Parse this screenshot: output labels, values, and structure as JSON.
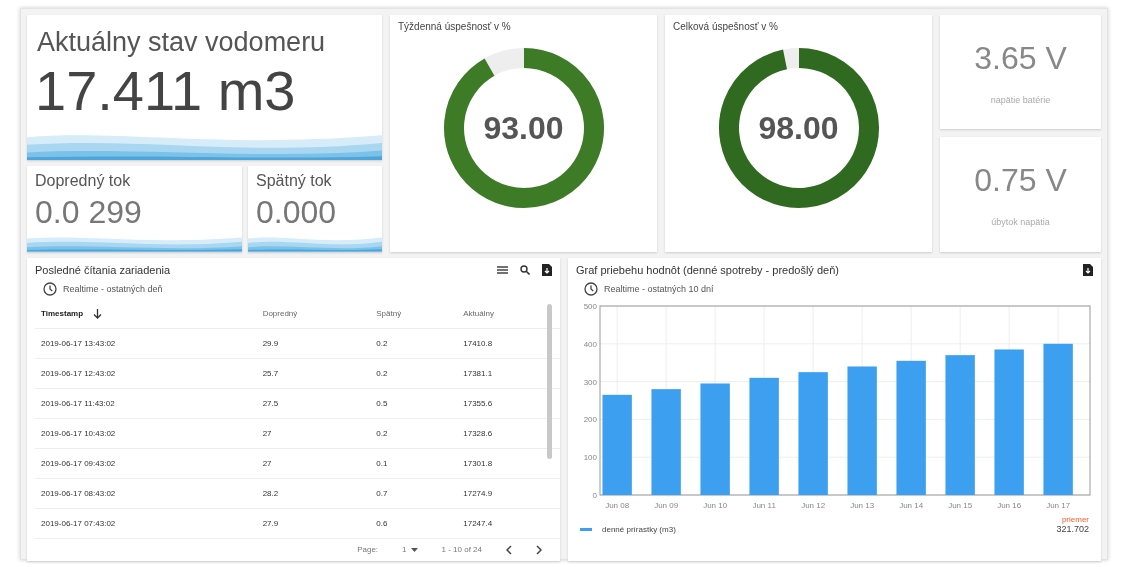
{
  "meter": {
    "title": "Aktuálny stav vodomeru",
    "value": "17.411 m3"
  },
  "flows": [
    {
      "label": "Dopredný tok",
      "value": "0.0 299"
    },
    {
      "label": "Spätný tok",
      "value": "0.000"
    }
  ],
  "gauges": [
    {
      "title": "Týždenná úspešnosť v %",
      "value": "93.00",
      "color": "#3d7b27"
    },
    {
      "title": "Celková úspešnosť v %",
      "value": "98.00",
      "color": "#306a20"
    }
  ],
  "stats": [
    {
      "value": "3.65 V",
      "label": "napätie batérie"
    },
    {
      "value": "0.75 V",
      "label": "úbytok napätia"
    }
  ],
  "readings": {
    "title": "Posledné čítania zariadenia",
    "subtitle": "Realtime - ostatných deň",
    "columns": [
      {
        "label": "Timestamp",
        "sorted": true
      },
      {
        "label": "Dopredný",
        "sorted": false
      },
      {
        "label": "Spätný",
        "sorted": false
      },
      {
        "label": "Aktuálny",
        "sorted": false
      }
    ],
    "rows": [
      [
        "2019-06-17 13:43:02",
        "29.9",
        "0.2",
        "17410.8"
      ],
      [
        "2019-06-17 12:43:02",
        "25.7",
        "0.2",
        "17381.1"
      ],
      [
        "2019-06-17 11:43:02",
        "27.5",
        "0.5",
        "17355.6"
      ],
      [
        "2019-06-17 10:43:02",
        "27",
        "0.2",
        "17328.6"
      ],
      [
        "2019-06-17 09:43:02",
        "27",
        "0.1",
        "17301.8"
      ],
      [
        "2019-06-17 08:43:02",
        "28.2",
        "0.7",
        "17274.9"
      ],
      [
        "2019-06-17 07:43:02",
        "27.9",
        "0.6",
        "17247.4"
      ]
    ],
    "pager": {
      "label": "Page:",
      "page": "1",
      "range": "1 - 10 of 24"
    }
  },
  "graph": {
    "title": "Graf priebehu hodnôt (denné spotreby - predošlý deň)",
    "subtitle": "Realtime - ostatných 10 dní",
    "chart_data": {
      "type": "bar",
      "categories": [
        "Jun 08",
        "Jun 09",
        "Jun 10",
        "Jun 11",
        "Jun 12",
        "Jun 13",
        "Jun 14",
        "Jun 15",
        "Jun 16",
        "Jun 17"
      ],
      "series": [
        {
          "name": "denné prírastky (m3)",
          "color": "#3d9ff0",
          "values": [
            265,
            280,
            295,
            310,
            325,
            340,
            355,
            370,
            385,
            400
          ]
        }
      ],
      "grid": true,
      "ylim": [
        0,
        500
      ],
      "yticks": [
        0,
        100,
        200,
        300,
        400,
        500
      ]
    },
    "avg_label": "priemer",
    "avg_value": "321.702"
  }
}
